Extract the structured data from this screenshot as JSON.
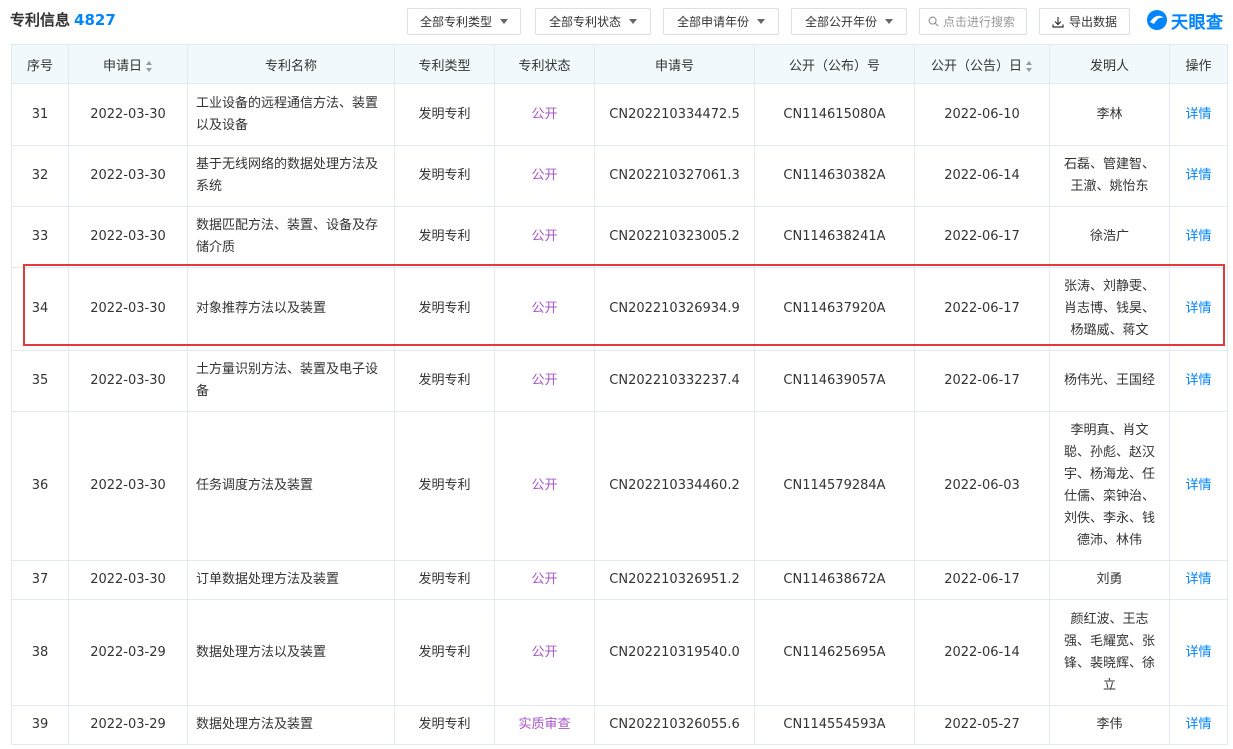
{
  "header": {
    "title": "专利信息",
    "count": "4827",
    "filters": [
      "全部专利类型",
      "全部专利状态",
      "全部申请年份",
      "全部公开年份"
    ],
    "search_placeholder": "点击进行搜索",
    "export_label": "导出数据",
    "logo_text": "天眼查"
  },
  "table": {
    "columns": [
      "序号",
      "申请日",
      "专利名称",
      "专利类型",
      "专利状态",
      "申请号",
      "公开（公布）号",
      "公开（公告）日",
      "发明人",
      "操作"
    ],
    "rows": [
      {
        "no": "31",
        "date": "2022-03-30",
        "name": "工业设备的远程通信方法、装置以及设备",
        "type": "发明专利",
        "status": "公开",
        "app_no": "CN202210334472.5",
        "pub_no": "CN114615080A",
        "pub_date": "2022-06-10",
        "inventors": "李林",
        "op": "详情"
      },
      {
        "no": "32",
        "date": "2022-03-30",
        "name": "基于无线网络的数据处理方法及系统",
        "type": "发明专利",
        "status": "公开",
        "app_no": "CN202210327061.3",
        "pub_no": "CN114630382A",
        "pub_date": "2022-06-14",
        "inventors": "石磊、管建智、王澈、姚怡东",
        "op": "详情"
      },
      {
        "no": "33",
        "date": "2022-03-30",
        "name": "数据匹配方法、装置、设备及存储介质",
        "type": "发明专利",
        "status": "公开",
        "app_no": "CN202210323005.2",
        "pub_no": "CN114638241A",
        "pub_date": "2022-06-17",
        "inventors": "徐浩广",
        "op": "详情"
      },
      {
        "no": "34",
        "date": "2022-03-30",
        "name": "对象推荐方法以及装置",
        "type": "发明专利",
        "status": "公开",
        "app_no": "CN202210326934.9",
        "pub_no": "CN114637920A",
        "pub_date": "2022-06-17",
        "inventors": "张涛、刘静雯、肖志博、钱昊、杨璐威、蒋文",
        "op": "详情"
      },
      {
        "no": "35",
        "date": "2022-03-30",
        "name": "土方量识别方法、装置及电子设备",
        "type": "发明专利",
        "status": "公开",
        "app_no": "CN202210332237.4",
        "pub_no": "CN114639057A",
        "pub_date": "2022-06-17",
        "inventors": "杨伟光、王国经",
        "op": "详情"
      },
      {
        "no": "36",
        "date": "2022-03-30",
        "name": "任务调度方法及装置",
        "type": "发明专利",
        "status": "公开",
        "app_no": "CN202210334460.2",
        "pub_no": "CN114579284A",
        "pub_date": "2022-06-03",
        "inventors": "李明真、肖文聪、孙彪、赵汉宇、杨海龙、任仕儒、栾钟治、刘佚、李永、钱德沛、林伟",
        "op": "详情"
      },
      {
        "no": "37",
        "date": "2022-03-30",
        "name": "订单数据处理方法及装置",
        "type": "发明专利",
        "status": "公开",
        "app_no": "CN202210326951.2",
        "pub_no": "CN114638672A",
        "pub_date": "2022-06-17",
        "inventors": "刘勇",
        "op": "详情"
      },
      {
        "no": "38",
        "date": "2022-03-29",
        "name": "数据处理方法以及装置",
        "type": "发明专利",
        "status": "公开",
        "app_no": "CN202210319540.0",
        "pub_no": "CN114625695A",
        "pub_date": "2022-06-14",
        "inventors": "颜红波、王志强、毛耀宽、张锋、裴晓辉、徐立",
        "op": "详情"
      },
      {
        "no": "39",
        "date": "2022-03-29",
        "name": "数据处理方法及装置",
        "type": "发明专利",
        "status": "实质审查",
        "app_no": "CN202210326055.6",
        "pub_no": "CN114554593A",
        "pub_date": "2022-05-27",
        "inventors": "李伟",
        "op": "详情"
      }
    ]
  }
}
